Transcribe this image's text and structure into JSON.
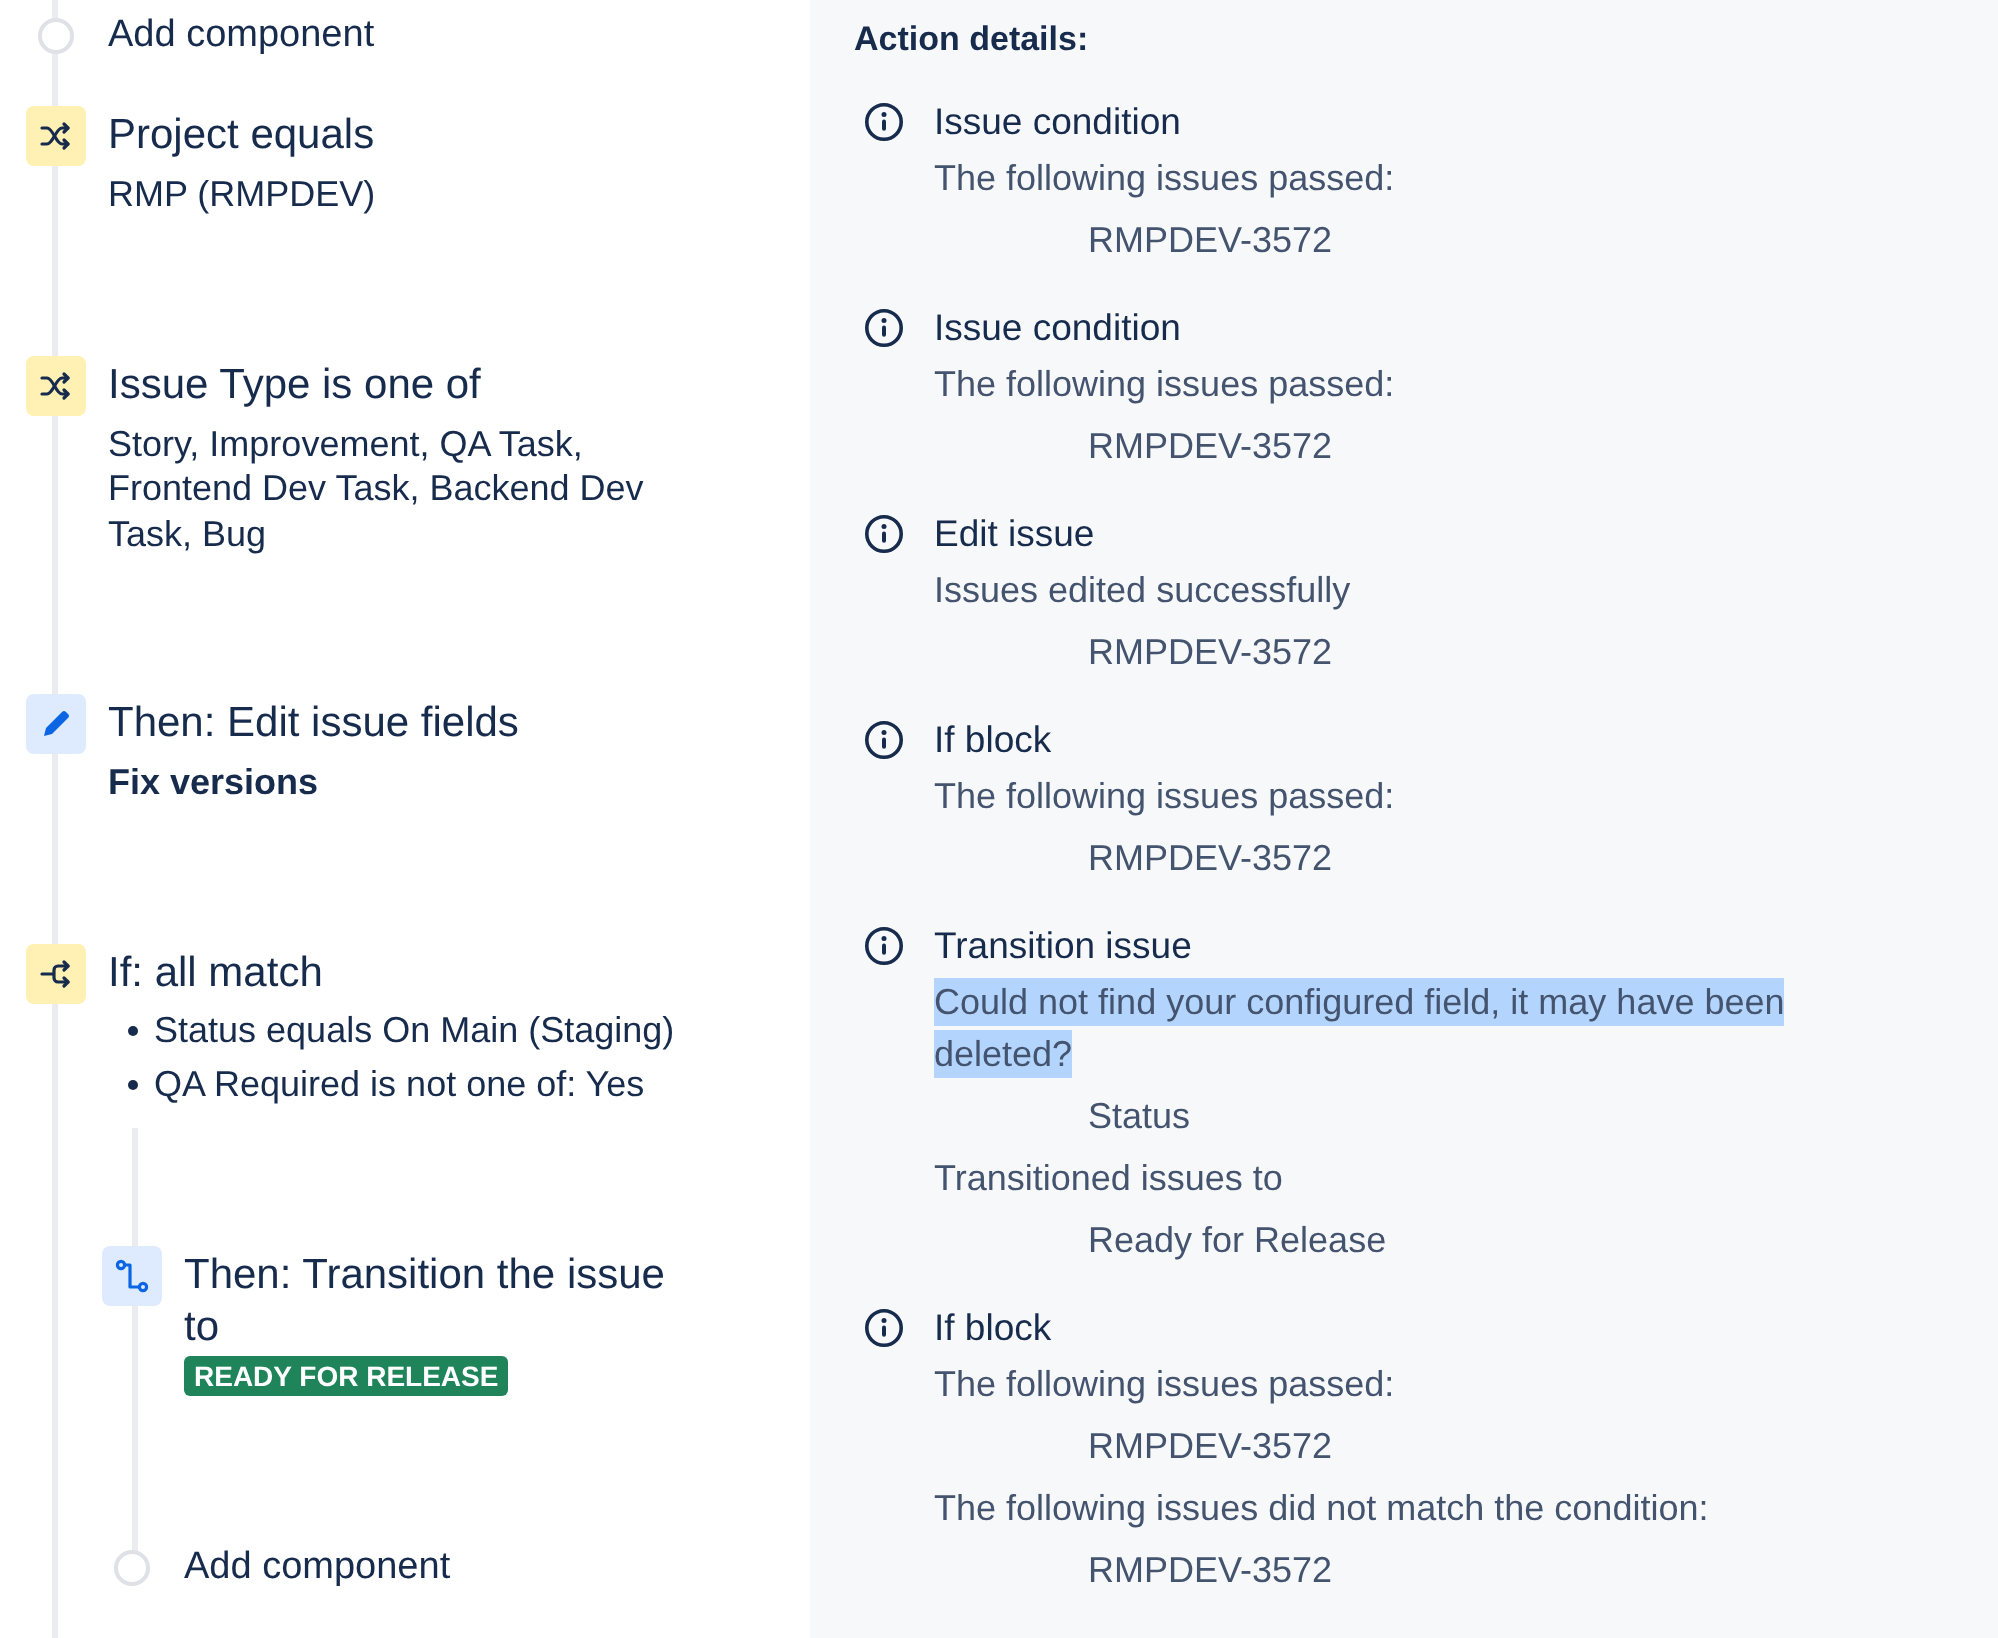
{
  "flow": {
    "items": [
      {
        "kind": "add",
        "label": "Add component"
      },
      {
        "kind": "condition",
        "title": "Project equals",
        "detail": "RMP (RMPDEV)"
      },
      {
        "kind": "condition",
        "title": "Issue Type is one of",
        "detail": "Story, Improvement, QA Task, Frontend Dev Task, Backend Dev Task, Bug"
      },
      {
        "kind": "edit",
        "title": "Then: Edit issue fields",
        "detail": "Fix versions"
      },
      {
        "kind": "if",
        "title": "If: all match",
        "bullets": [
          "Status equals On Main (Staging)",
          "QA Required is not one of: Yes"
        ],
        "children": [
          {
            "kind": "transition",
            "title": "Then: Transition the issue to",
            "lozenge": "READY FOR RELEASE"
          },
          {
            "kind": "add",
            "label": "Add component"
          }
        ]
      }
    ]
  },
  "action_details": {
    "title": "Action details:",
    "entries": [
      {
        "title": "Issue condition",
        "lines": [
          {
            "kind": "message",
            "text": "The following issues passed:",
            "highlighted": false
          },
          {
            "kind": "value",
            "text": "RMPDEV-3572",
            "highlighted": false
          }
        ]
      },
      {
        "title": "Issue condition",
        "lines": [
          {
            "kind": "message",
            "text": "The following issues passed:",
            "highlighted": false
          },
          {
            "kind": "value",
            "text": "RMPDEV-3572",
            "highlighted": false
          }
        ]
      },
      {
        "title": "Edit issue",
        "lines": [
          {
            "kind": "message",
            "text": "Issues edited successfully",
            "highlighted": false
          },
          {
            "kind": "value",
            "text": "RMPDEV-3572",
            "highlighted": false
          }
        ]
      },
      {
        "title": "If block",
        "lines": [
          {
            "kind": "message",
            "text": "The following issues passed:",
            "highlighted": false
          },
          {
            "kind": "value",
            "text": "RMPDEV-3572",
            "highlighted": false
          }
        ]
      },
      {
        "title": "Transition issue",
        "lines": [
          {
            "kind": "message",
            "text": "Could not find your configured field, it may have been deleted?",
            "highlighted": true
          },
          {
            "kind": "value",
            "text": "Status",
            "highlighted": false
          },
          {
            "kind": "message",
            "text": "Transitioned issues to",
            "highlighted": false
          },
          {
            "kind": "value",
            "text": "Ready for Release",
            "highlighted": false
          }
        ]
      },
      {
        "title": "If block",
        "lines": [
          {
            "kind": "message",
            "text": "The following issues passed:",
            "highlighted": false
          },
          {
            "kind": "value",
            "text": "RMPDEV-3572",
            "highlighted": false
          },
          {
            "kind": "message",
            "text": "The following issues did not match the condition:",
            "highlighted": false
          },
          {
            "kind": "value",
            "text": "RMPDEV-3572",
            "highlighted": false
          }
        ]
      }
    ]
  }
}
